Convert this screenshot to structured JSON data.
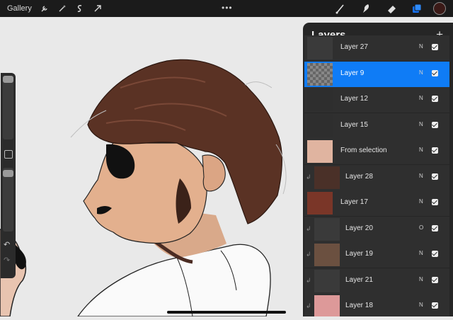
{
  "topbar": {
    "gallery_label": "Gallery",
    "left_tools": [
      "wrench-icon",
      "magic-wand-icon",
      "selection-icon",
      "transform-arrow-icon"
    ],
    "center_menu": "•••",
    "right_tools": [
      "brush-icon",
      "smudge-icon",
      "eraser-icon",
      "layers-icon"
    ],
    "color": "#3b1a17"
  },
  "sidebar": {
    "undo": "↶",
    "redo": "↷"
  },
  "layers_panel": {
    "title": "Layers",
    "add": "+",
    "accent": "#0f7cf6",
    "layers": [
      {
        "name": "Layer 27",
        "blend": "N",
        "clipped": false,
        "selected": false
      },
      {
        "name": "Layer 9",
        "blend": "N",
        "clipped": false,
        "selected": true
      },
      {
        "name": "Layer 12",
        "blend": "N",
        "clipped": false,
        "selected": false
      },
      {
        "name": "Layer 15",
        "blend": "N",
        "clipped": false,
        "selected": false
      },
      {
        "name": "From selection",
        "blend": "N",
        "clipped": false,
        "selected": false
      },
      {
        "name": "Layer 28",
        "blend": "N",
        "clipped": true,
        "selected": false
      },
      {
        "name": "Layer 17",
        "blend": "N",
        "clipped": false,
        "selected": false
      },
      {
        "name": "Layer 20",
        "blend": "O",
        "clipped": true,
        "selected": false
      },
      {
        "name": "Layer 19",
        "blend": "N",
        "clipped": true,
        "selected": false
      },
      {
        "name": "Layer 21",
        "blend": "N",
        "clipped": true,
        "selected": false
      },
      {
        "name": "Layer 18",
        "blend": "N",
        "clipped": true,
        "selected": false
      }
    ]
  }
}
